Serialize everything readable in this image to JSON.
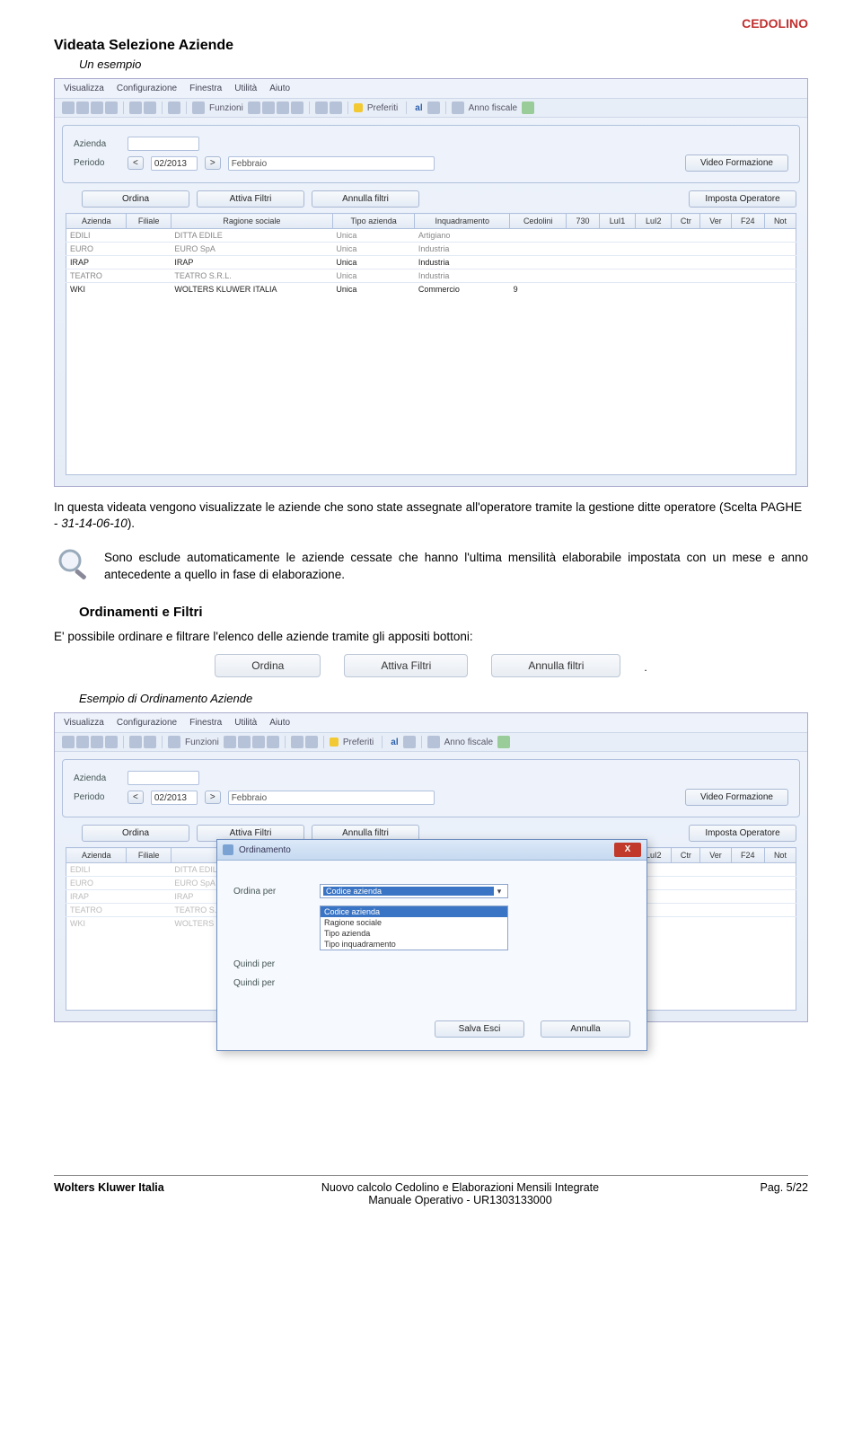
{
  "header_tag": "CEDOLINO",
  "section_title": "Videata Selezione Aziende",
  "subtitle": "Un esempio",
  "screenshot1": {
    "menu": [
      "Visualizza",
      "Configurazione",
      "Finestra",
      "Utilità",
      "Aiuto"
    ],
    "toolbar": {
      "funzioni": "Funzioni",
      "preferiti": "Preferiti",
      "anno_fiscale": "Anno fiscale",
      "al": "al"
    },
    "form": {
      "azienda_label": "Azienda",
      "periodo_label": "Periodo",
      "periodo_value": "02/2013",
      "mese_label": "Febbraio",
      "video_formazione": "Video Formazione"
    },
    "buttons": {
      "ordina": "Ordina",
      "attiva_filtri": "Attiva Filtri",
      "annulla_filtri": "Annulla filtri",
      "imposta_operatore": "Imposta Operatore"
    },
    "columns": [
      "Azienda",
      "Filiale",
      "Ragione sociale",
      "Tipo azienda",
      "Inquadramento",
      "Cedolini",
      "730",
      "LuI1",
      "LuI2",
      "Ctr",
      "Ver",
      "F24",
      "Not"
    ],
    "rows": [
      {
        "azienda": "EDILI",
        "filiale": "",
        "ragione": "DITTA EDILE",
        "tipo": "Unica",
        "inq": "Artigiano",
        "cedolini": "",
        "active": false
      },
      {
        "azienda": "EURO",
        "filiale": "",
        "ragione": "EURO SpA",
        "tipo": "Unica",
        "inq": "Industria",
        "cedolini": "",
        "active": false
      },
      {
        "azienda": "IRAP",
        "filiale": "",
        "ragione": "IRAP",
        "tipo": "Unica",
        "inq": "Industria",
        "cedolini": "",
        "active": true
      },
      {
        "azienda": "TEATRO",
        "filiale": "",
        "ragione": "TEATRO S.R.L.",
        "tipo": "Unica",
        "inq": "Industria",
        "cedolini": "",
        "active": false
      },
      {
        "azienda": "WKI",
        "filiale": "",
        "ragione": "WOLTERS KLUWER ITALIA",
        "tipo": "Unica",
        "inq": "Commercio",
        "cedolini": "9",
        "active": true
      }
    ]
  },
  "para1_a": "In questa videata vengono visualizzate le aziende che sono state assegnate all'operatore tramite la gestione ditte operatore (Scelta PAGHE - ",
  "para1_b": "31-14-06-10",
  "para1_c": ").",
  "note_text": "Sono esclude automaticamente le aziende cessate che hanno l'ultima mensilità elaborabile impostata con un mese e anno antecedente a quello in fase di elaborazione.",
  "subsection": "Ordinamenti e Filtri",
  "para2": "E' possibile ordinare e filtrare l'elenco delle aziende tramite gli appositi bottoni:",
  "pillbar": {
    "ordina": "Ordina",
    "attiva": "Attiva Filtri",
    "annulla": "Annulla filtri"
  },
  "example2_label": "Esempio di Ordinamento Aziende",
  "dialog": {
    "title": "Ordinamento",
    "ordina_per": "Ordina per",
    "quindi_per": "Quindi per",
    "selected": "Codice azienda",
    "options": [
      "Codice azienda",
      "Ragione sociale",
      "Tipo azienda",
      "Tipo inquadramento"
    ],
    "salva": "Salva Esci",
    "annulla": "Annulla",
    "close": "X"
  },
  "footer": {
    "left": "Wolters Kluwer Italia",
    "mid1": "Nuovo calcolo Cedolino e Elaborazioni Mensili Integrate",
    "mid2": "Manuale Operativo - UR1303133000",
    "right": "Pag.   5/22"
  }
}
